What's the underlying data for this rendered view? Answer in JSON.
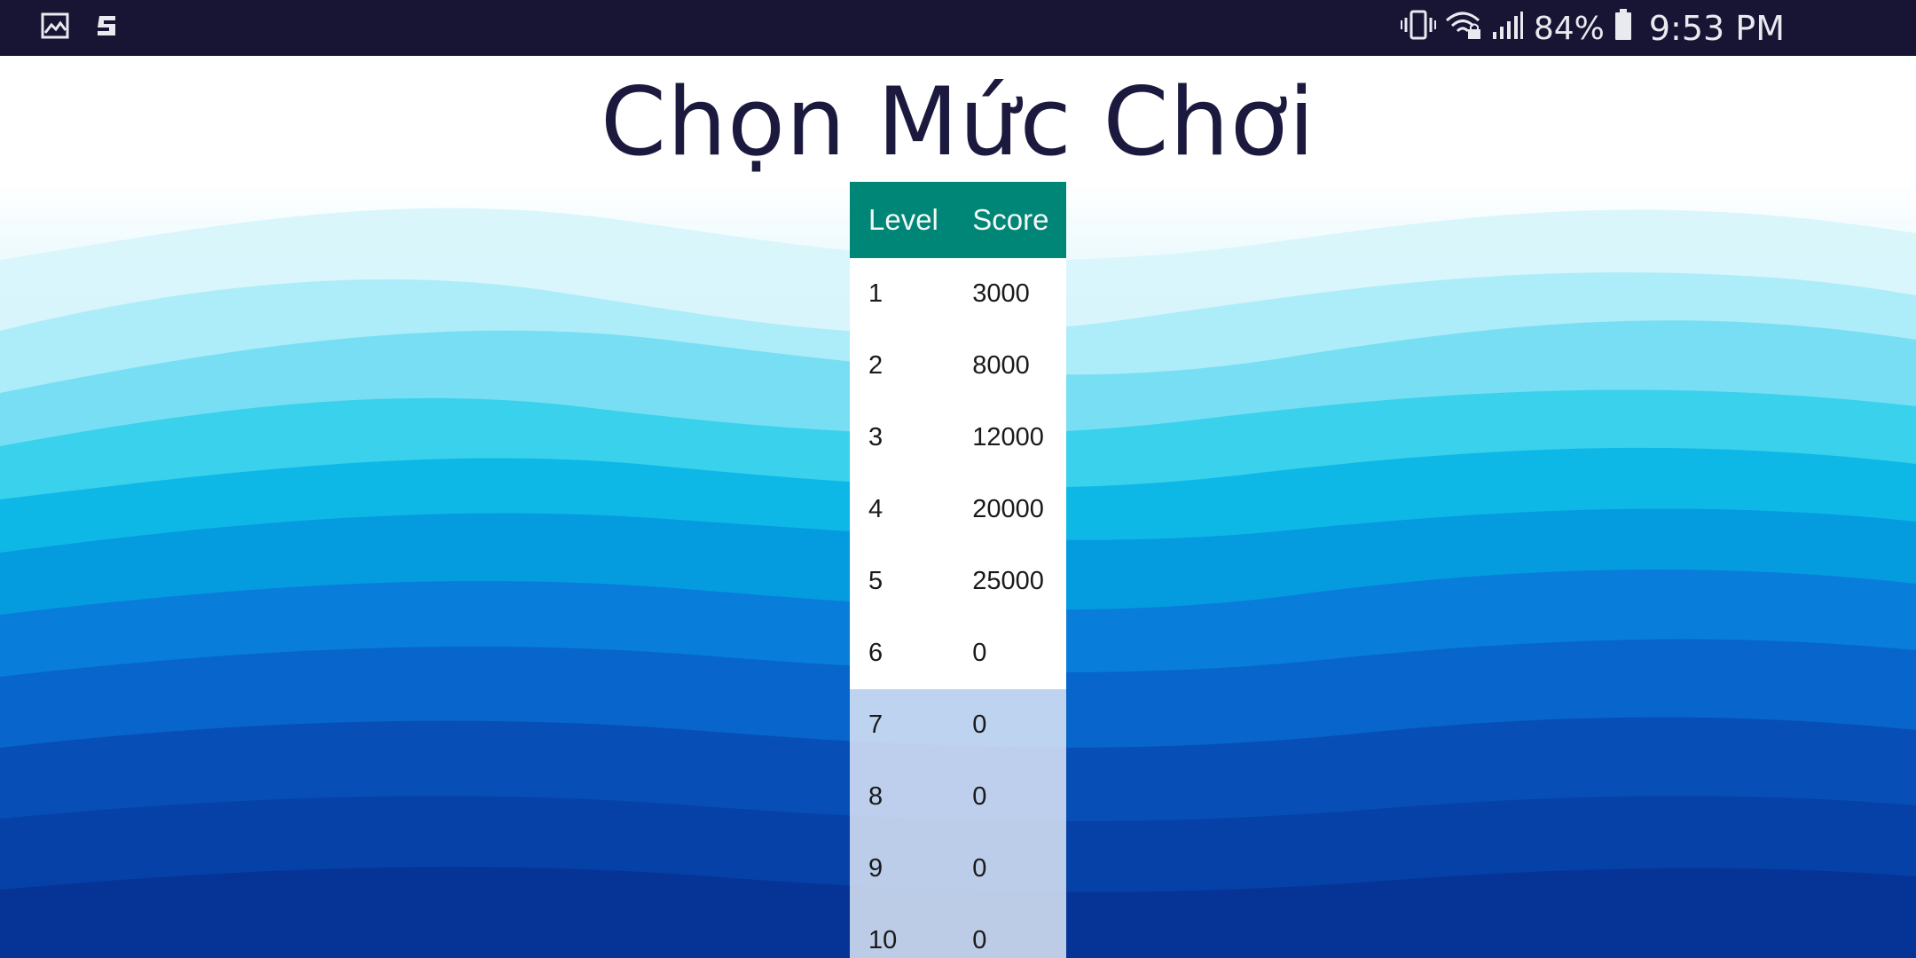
{
  "status_bar": {
    "left_icons": [
      "image-icon",
      "app-notification-icon"
    ],
    "right_icons": [
      "vibrate-icon",
      "wifi-lock-icon",
      "signal-icon"
    ],
    "battery_percent": "84%",
    "time": "9:53 PM",
    "background_color": "#181434"
  },
  "page": {
    "title": "Chọn Mức Chơi"
  },
  "table": {
    "header_color": "#008676",
    "columns": [
      "Level",
      "Score"
    ],
    "rows": [
      {
        "level": "1",
        "score": "3000"
      },
      {
        "level": "2",
        "score": "8000"
      },
      {
        "level": "3",
        "score": "12000"
      },
      {
        "level": "4",
        "score": "20000"
      },
      {
        "level": "5",
        "score": "25000"
      },
      {
        "level": "6",
        "score": "0"
      },
      {
        "level": "7",
        "score": "0"
      },
      {
        "level": "8",
        "score": "0"
      },
      {
        "level": "9",
        "score": "0"
      },
      {
        "level": "10",
        "score": "0"
      }
    ]
  }
}
